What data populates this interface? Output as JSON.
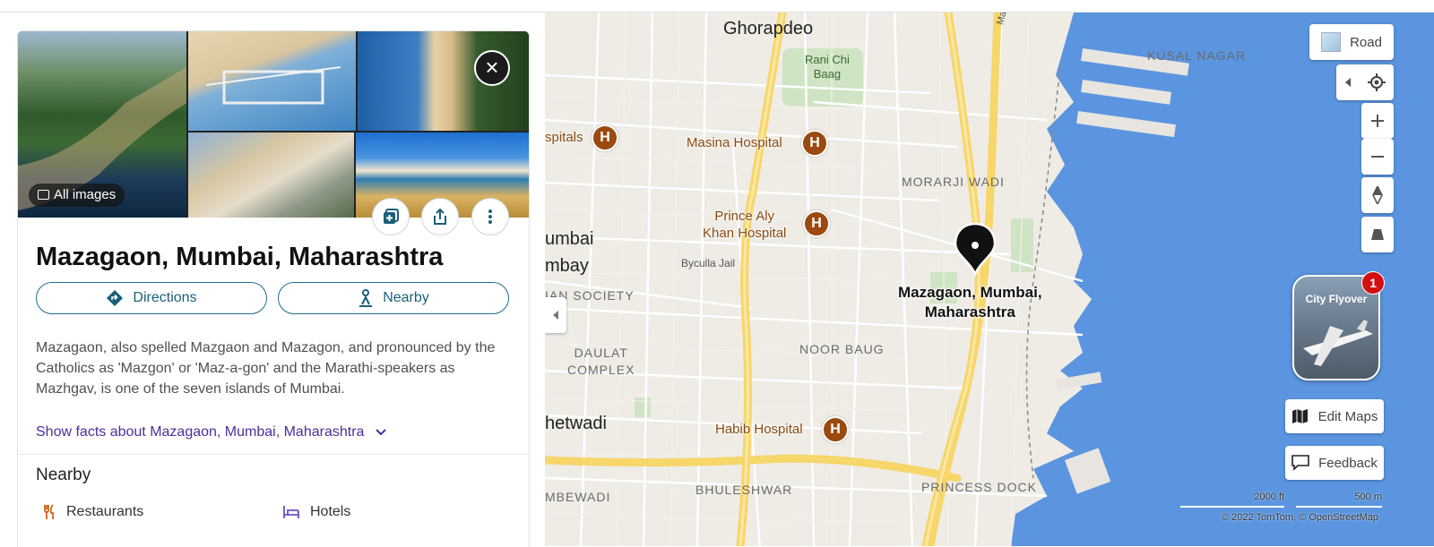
{
  "gallery": {
    "all_images_label": "All images"
  },
  "place": {
    "title": "Mazagaon, Mumbai, Maharashtra",
    "directions_label": "Directions",
    "nearby_label": "Nearby",
    "description": "Mazagaon, also spelled Mazgaon and Mazagon, and pronounced by the Catholics as 'Mazgon' or 'Maz-a-gon' and the Marathi-speakers as Mazhgav, is one of the seven islands of Mumbai.",
    "facts_link": "Show facts about Mazagaon, Mumbai, Maharashtra"
  },
  "nearby": {
    "heading": "Nearby",
    "items": [
      {
        "label": "Restaurants",
        "icon": "fork-knife-icon"
      },
      {
        "label": "Hotels",
        "icon": "bed-icon"
      }
    ]
  },
  "map": {
    "style_label": "Road",
    "flyover_label": "City Flyover",
    "flyover_badge": "1",
    "edit_maps_label": "Edit Maps",
    "feedback_label": "Feedback",
    "scale_ft": "2000 ft",
    "scale_m": "500 m",
    "copyright": "© 2022 TomTom, © OpenStreetMap",
    "pin_label_line1": "Mazagaon, Mumbai,",
    "pin_label_line2": "Maharashtra",
    "labels": {
      "ghorapdeo": "Ghorapdeo",
      "rani_chi_baag_1": "Rani Chi",
      "rani_chi_baag_2": "Baag",
      "kusal_nagar": "KUSAL NAGAR",
      "hospitals": "spitals",
      "masina": "Masina Hospital",
      "morarji_wadi": "MORARJI WADI",
      "prince_aly_1": "Prince Aly",
      "prince_aly_2": "Khan Hospital",
      "umbai": "umbai",
      "mbay": "mbay",
      "byculla_jail": "Byculla Jail",
      "society": "IAN SOCIETY",
      "daulat_1": "DAULAT",
      "daulat_2": "COMPLEX",
      "noor_baug": "NOOR BAUG",
      "hetwadi": "hetwadi",
      "habib": "Habib Hospital",
      "mbewadi": "MBEWADI",
      "bhuleshwar": "BHULESHWAR",
      "princess_dock": "PRINCESS DOCK",
      "mahul_rd": "Mahul R"
    },
    "colors": {
      "water": "#5b95e0",
      "road_major": "#f7d66a",
      "hospital": "#9a4a0e",
      "park": "#cfe4c4"
    }
  }
}
